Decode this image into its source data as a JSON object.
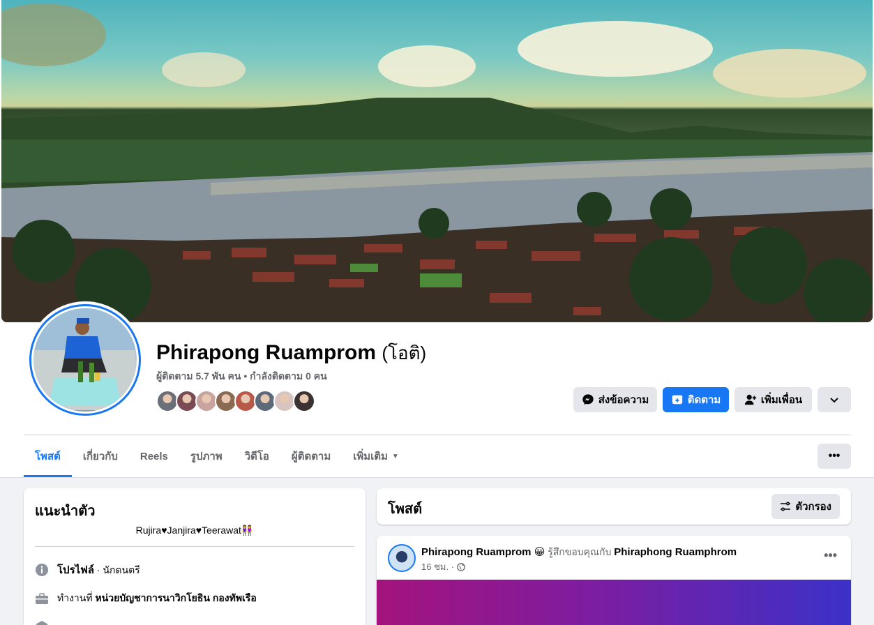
{
  "profile": {
    "name": "Phirapong Ruamprom",
    "nickname": "(โอติ)",
    "stats": "ผู้ติดตาม 5.7 พัน คน • กำลังติดตาม 0 คน",
    "friend_avatar_colors": [
      "#6b6f78",
      "#7a4a55",
      "#c9a3a0",
      "#8a6a50",
      "#b85a4a",
      "#5d6a7a",
      "#d8c4c0",
      "#3c3232"
    ]
  },
  "actions": {
    "message": "ส่งข้อความ",
    "follow": "ติดตาม",
    "add_friend": "เพิ่มเพื่อน"
  },
  "tabs": [
    {
      "label": "โพสต์",
      "active": true
    },
    {
      "label": "เกี่ยวกับ"
    },
    {
      "label": "Reels"
    },
    {
      "label": "รูปภาพ"
    },
    {
      "label": "วิดีโอ"
    },
    {
      "label": "ผู้ติดตาม"
    },
    {
      "label": "เพิ่มเติม"
    }
  ],
  "intro": {
    "title": "แนะนำตัว",
    "bio": "Rujira♥Janjira♥Teerawat👭",
    "profile_label": "โปรไฟล์",
    "profile_value": " · นักดนตรี",
    "work_prefix": "ทำงานที่ ",
    "work_place": "หน่วยบัญชาการนาวิกโยธิน กองทัพเรือ"
  },
  "posts_header": {
    "title": "โพสต์",
    "filter": "ตัวกรอง"
  },
  "post": {
    "author": "Phirapong Ruamprom",
    "emoji": "😀",
    "feeling": " รู้สึกขอบคุณกับ ",
    "tagged": "Phiraphong Ruamphrom",
    "time": "16 ชม. ·"
  },
  "colors": {
    "accent": "#1877f2",
    "button_grey": "#e4e6eb",
    "secondary_text": "#65676b"
  }
}
